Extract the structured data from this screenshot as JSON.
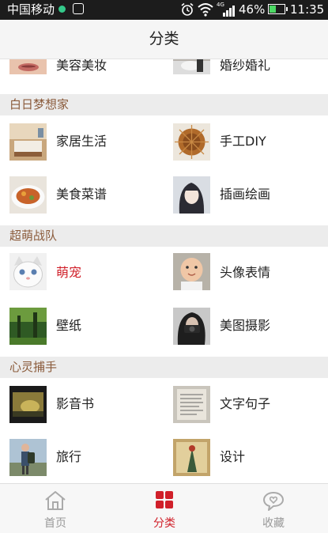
{
  "status_bar": {
    "carrier": "中国移动",
    "network": "4G",
    "battery": "46%",
    "battery_level": 0.46,
    "time": "11:35"
  },
  "title": "分类",
  "top_partial_row": [
    {
      "label": "美容美妆",
      "icon": "lips-makeup-thumbnail"
    },
    {
      "label": "婚纱婚礼",
      "icon": "wedding-couple-thumbnail"
    }
  ],
  "sections": [
    {
      "title": "白日梦想家",
      "items": [
        {
          "label": "家居生活",
          "icon": "bedroom-interior-thumbnail"
        },
        {
          "label": "手工DIY",
          "icon": "spiky-ball-craft-thumbnail"
        },
        {
          "label": "美食菜谱",
          "icon": "dish-food-thumbnail"
        },
        {
          "label": "插画绘画",
          "icon": "anime-girl-illustration-thumbnail"
        }
      ]
    },
    {
      "title": "超萌战队",
      "items": [
        {
          "label": "萌宠",
          "icon": "white-cat-thumbnail",
          "active": true
        },
        {
          "label": "头像表情",
          "icon": "baby-face-thumbnail"
        },
        {
          "label": "壁纸",
          "icon": "green-forest-thumbnail"
        },
        {
          "label": "美图摄影",
          "icon": "girl-camera-thumbnail"
        }
      ]
    },
    {
      "title": "心灵捕手",
      "items": [
        {
          "label": "影音书",
          "icon": "film-frame-thumbnail"
        },
        {
          "label": "文字句子",
          "icon": "written-text-thumbnail"
        },
        {
          "label": "旅行",
          "icon": "backpacker-thumbnail"
        },
        {
          "label": "设计",
          "icon": "design-poster-thumbnail"
        }
      ]
    }
  ],
  "tabs": [
    {
      "label": "首页",
      "icon": "home-icon"
    },
    {
      "label": "分类",
      "icon": "category-grid-icon",
      "active": true
    },
    {
      "label": "收藏",
      "icon": "favorites-chat-heart-icon"
    }
  ],
  "colors": {
    "accent": "#d0202a",
    "section_title": "#8a5a3a",
    "section_bg": "#ececec",
    "tab_inactive": "#999999"
  }
}
